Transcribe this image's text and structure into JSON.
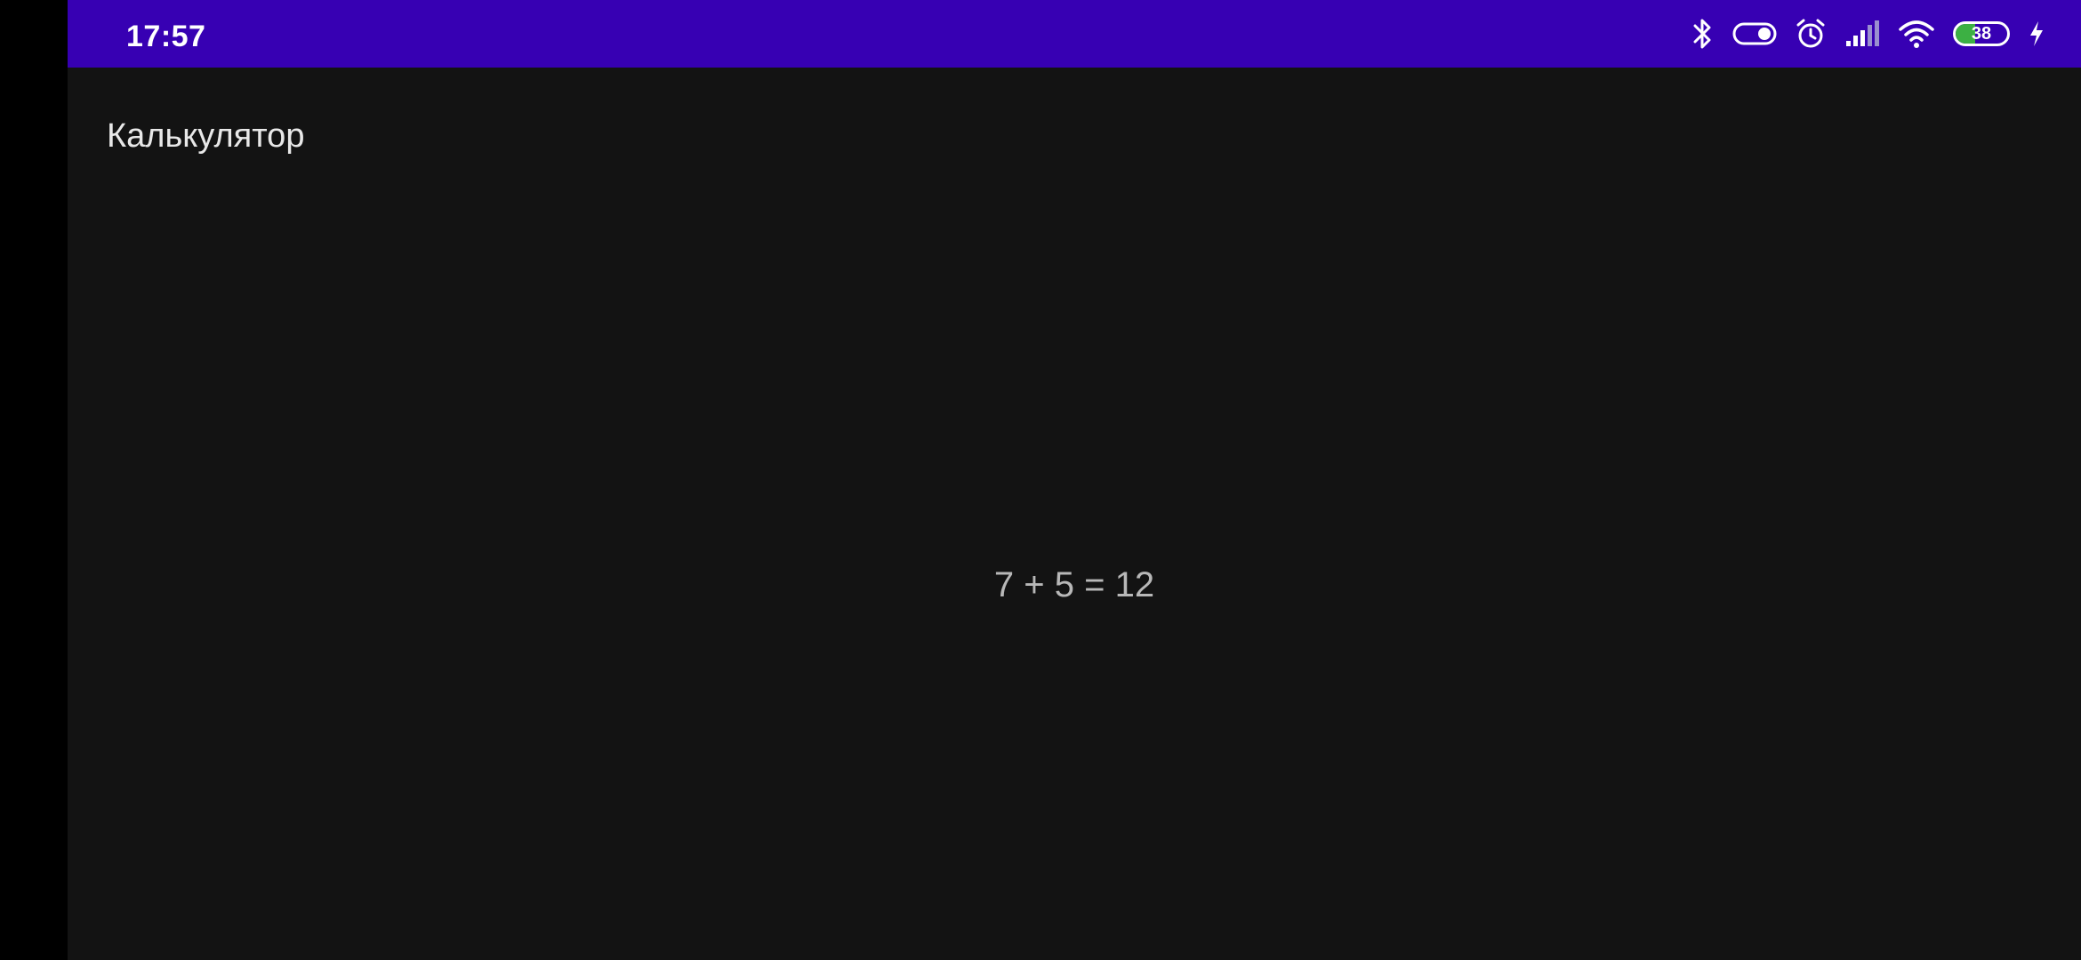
{
  "status_bar": {
    "time": "17:57",
    "background": "#3700b3",
    "icons": [
      "bluetooth-icon",
      "toggle-icon",
      "alarm-icon",
      "signal-icon",
      "wifi-icon",
      "battery-icon",
      "charging-icon"
    ],
    "battery": {
      "level_text": "38",
      "level_fraction": 0.38,
      "charging": true,
      "fill_color": "#3cb043"
    }
  },
  "app": {
    "title": "Калькулятор",
    "background": "#131313"
  },
  "main": {
    "expression": "7 + 5 = 12"
  }
}
